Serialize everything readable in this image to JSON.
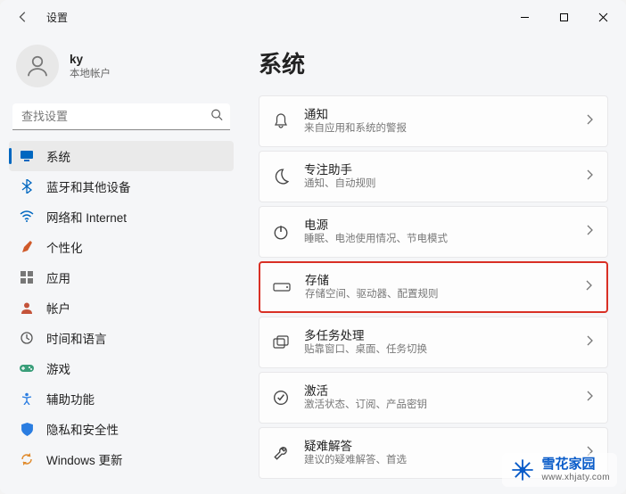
{
  "window": {
    "title": "设置"
  },
  "profile": {
    "name": "ky",
    "subtitle": "本地帐户"
  },
  "search": {
    "placeholder": "查找设置"
  },
  "sidebar": {
    "items": [
      {
        "label": "系统",
        "icon": "system-icon",
        "color": "#0067c0",
        "selected": true
      },
      {
        "label": "蓝牙和其他设备",
        "icon": "bluetooth-icon",
        "color": "#0067c0"
      },
      {
        "label": "网络和 Internet",
        "icon": "wifi-icon",
        "color": "#0067c0"
      },
      {
        "label": "个性化",
        "icon": "brush-icon",
        "color": "#d05a2a"
      },
      {
        "label": "应用",
        "icon": "apps-icon",
        "color": "#5b5b5b"
      },
      {
        "label": "帐户",
        "icon": "account-icon",
        "color": "#c4533a"
      },
      {
        "label": "时间和语言",
        "icon": "clock-icon",
        "color": "#555"
      },
      {
        "label": "游戏",
        "icon": "game-icon",
        "color": "#3a9"
      },
      {
        "label": "辅助功能",
        "icon": "accessibility-icon",
        "color": "#2a7de1"
      },
      {
        "label": "隐私和安全性",
        "icon": "shield-icon",
        "color": "#2a7de1"
      },
      {
        "label": "Windows 更新",
        "icon": "update-icon",
        "color": "#e08a2c"
      }
    ]
  },
  "main": {
    "title": "系统",
    "items": [
      {
        "title": "通知",
        "subtitle": "来自应用和系统的警报",
        "icon": "bell-icon"
      },
      {
        "title": "专注助手",
        "subtitle": "通知、自动规则",
        "icon": "moon-icon"
      },
      {
        "title": "电源",
        "subtitle": "睡眠、电池使用情况、节电模式",
        "icon": "power-icon"
      },
      {
        "title": "存储",
        "subtitle": "存储空间、驱动器、配置规则",
        "icon": "storage-icon",
        "highlighted": true
      },
      {
        "title": "多任务处理",
        "subtitle": "贴靠窗口、桌面、任务切换",
        "icon": "multitask-icon"
      },
      {
        "title": "激活",
        "subtitle": "激活状态、订阅、产品密钥",
        "icon": "activation-icon"
      },
      {
        "title": "疑难解答",
        "subtitle": "建议的疑难解答、首选",
        "icon": "troubleshoot-icon"
      }
    ]
  },
  "watermark": {
    "brand": "雪花家园",
    "url": "www.xhjaty.com"
  }
}
